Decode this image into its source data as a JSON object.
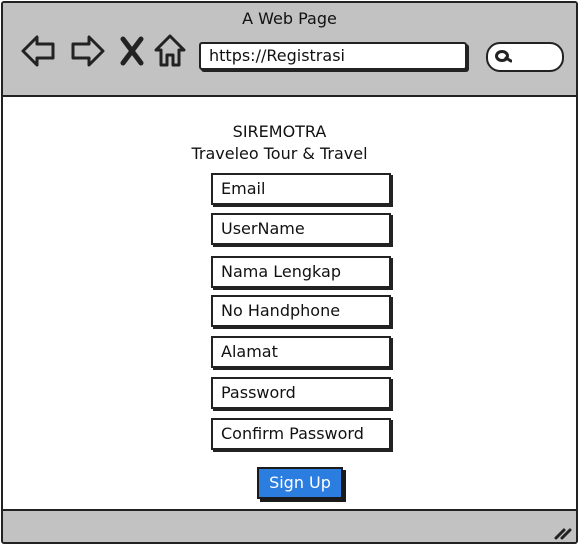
{
  "window": {
    "title": "A Web Page"
  },
  "nav": {
    "back_icon": "back-arrow-icon",
    "forward_icon": "forward-arrow-icon",
    "close_icon": "close-icon",
    "home_icon": "home-icon",
    "url": "https://Registrasi",
    "search_icon": "search-icon"
  },
  "form": {
    "brand": "SIREMOTRA",
    "subtitle": "Traveleo Tour & Travel",
    "fields": [
      {
        "label": "Email"
      },
      {
        "label": "UserName"
      },
      {
        "label": "Nama Lengkap"
      },
      {
        "label": "No Handphone"
      },
      {
        "label": "Alamat"
      },
      {
        "label": "Password"
      },
      {
        "label": "Confirm Password"
      }
    ],
    "submit_label": "Sign Up",
    "submit_color": "#2b7de0"
  }
}
